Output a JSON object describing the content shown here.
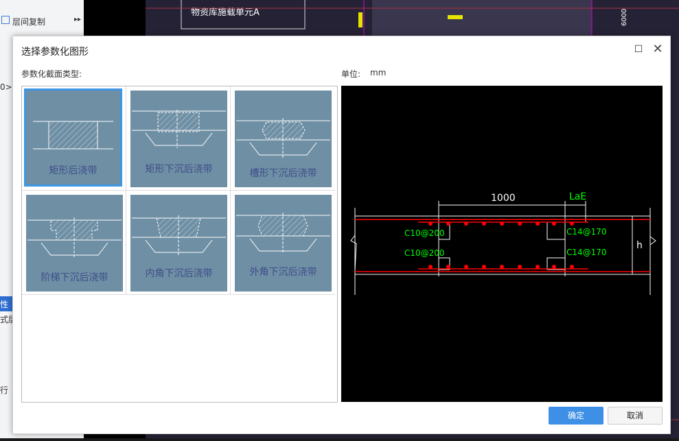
{
  "background": {
    "floor_copy_label": "层间复制",
    "left_fragment_1": "0>",
    "left_fragment_2": "性值",
    "left_fragment_3": "式层",
    "left_fragment_4": "行",
    "cad_text_1": "物资库施载单元A",
    "cad_text_2": "6000"
  },
  "dialog": {
    "title": "选择参数化图形",
    "section_type_label": "参数化截面类型:",
    "unit_label": "单位:",
    "unit_value": "mm",
    "ok_label": "确定",
    "cancel_label": "取消",
    "shapes": [
      {
        "label": "矩形后浇带",
        "selected": true
      },
      {
        "label": "矩形下沉后浇带",
        "selected": false
      },
      {
        "label": "槽形下沉后浇带",
        "selected": false
      },
      {
        "label": "阶梯下沉后浇带",
        "selected": false
      },
      {
        "label": "内角下沉后浇带",
        "selected": false
      },
      {
        "label": "外角下沉后浇带",
        "selected": false
      }
    ]
  },
  "preview": {
    "dim_width": "1000",
    "dim_lae": "LaE",
    "rebar_top_left": "C10@200",
    "rebar_bottom_left": "C10@200",
    "rebar_top_right": "C14@170",
    "rebar_bottom_right": "C14@170",
    "dim_h": "h"
  },
  "colors": {
    "accent": "#3e8fe6",
    "thumb_bg": "#6e8fa4",
    "thumb_text": "#3f4d8a",
    "rebar_red": "#ff0000",
    "label_green": "#00ff00"
  }
}
